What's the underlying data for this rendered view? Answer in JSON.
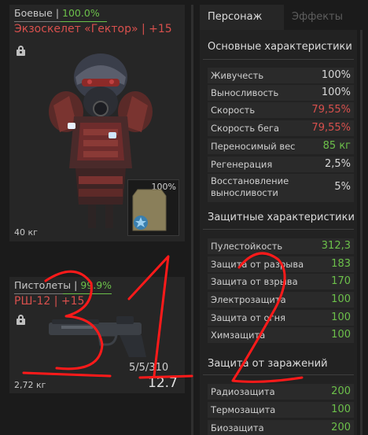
{
  "armor": {
    "category": "Боевые",
    "separator": "|",
    "durability": "100.0%",
    "name": "Экзоскелет «Гектор» | +15",
    "weight": "40 кг",
    "plate_durability": "100%"
  },
  "weapon": {
    "category": "Пистолеты",
    "separator": "|",
    "durability": "99.9%",
    "name": "РШ-12 | +15",
    "weight": "2,72 кг",
    "ammo": "5/5/310",
    "mag": "12.7"
  },
  "tabs": [
    {
      "label": "Персонаж",
      "active": true
    },
    {
      "label": "Эффекты",
      "active": false
    }
  ],
  "sections": {
    "basic": {
      "title": "Основные характеристики",
      "rows": [
        {
          "label": "Живучесть",
          "value": "100%",
          "color": "white"
        },
        {
          "label": "Выносливость",
          "value": "100%",
          "color": "white"
        },
        {
          "label": "Скорость",
          "value": "79,55%",
          "color": "red"
        },
        {
          "label": "Скорость бега",
          "value": "79,55%",
          "color": "red"
        },
        {
          "label": "Переносимый вес",
          "value": "85 кг",
          "color": "green"
        },
        {
          "label": "Регенерация",
          "value": "2,5%",
          "color": "white"
        },
        {
          "label": "Восстановление выносливости",
          "value": "5%",
          "color": "white"
        }
      ]
    },
    "protection": {
      "title": "Защитные характеристики",
      "rows": [
        {
          "label": "Пулестойкость",
          "value": "312,3",
          "color": "green"
        },
        {
          "label": "Защита от разрыва",
          "value": "183",
          "color": "green"
        },
        {
          "label": "Защита от взрыва",
          "value": "170",
          "color": "green"
        },
        {
          "label": "Электрозащита",
          "value": "100",
          "color": "green"
        },
        {
          "label": "Защита от огня",
          "value": "100",
          "color": "green"
        },
        {
          "label": "Химзащита",
          "value": "100",
          "color": "green"
        }
      ]
    },
    "contamination": {
      "title": "Защита от заражений",
      "rows": [
        {
          "label": "Радиозащита",
          "value": "200",
          "color": "green"
        },
        {
          "label": "Термозащита",
          "value": "100",
          "color": "green"
        },
        {
          "label": "Биозащита",
          "value": "200",
          "color": "green"
        }
      ]
    }
  },
  "annotations": [
    "3",
    "1",
    "2"
  ],
  "colors": {
    "red": "#d8504d",
    "green": "#6cc04a",
    "annotation": "#ff1a1a"
  },
  "icons": [
    "lock-icon",
    "lock-icon"
  ]
}
